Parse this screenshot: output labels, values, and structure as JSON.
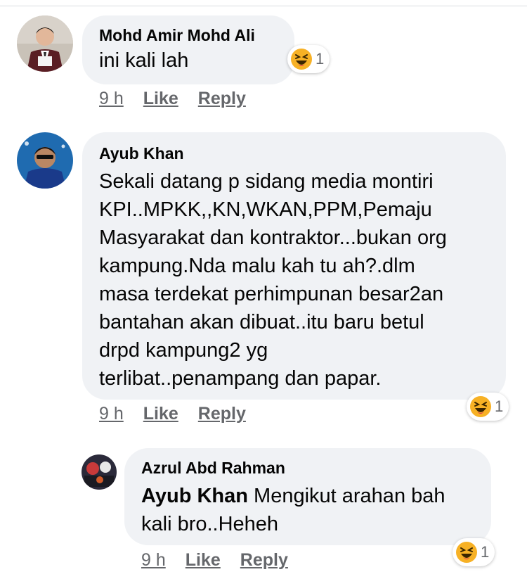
{
  "comments": [
    {
      "author": "Mohd Amir Mohd Ali",
      "text": "ini kali lah",
      "time": "9 h",
      "like": "Like",
      "reply": "Reply",
      "reaction": {
        "icon": "haha-emoji-icon",
        "count": "1"
      }
    },
    {
      "author": "Ayub Khan",
      "lines": [
        "Sekali datang p sidang media montiri",
        "KPI..MPKK,,KN,WKAN,PPM,Pemaju",
        "Masyarakat dan kontraktor...bukan org",
        "kampung.Nda malu kah tu ah?.dlm",
        "masa terdekat perhimpunan besar2an",
        "bantahan akan dibuat..itu baru betul",
        "drpd kampung2 yg",
        "terlibat..penampang dan papar."
      ],
      "time": "9 h",
      "like": "Like",
      "reply": "Reply",
      "reaction": {
        "icon": "haha-emoji-icon",
        "count": "1"
      }
    },
    {
      "author": "Azrul Abd Rahman",
      "mention": "Ayub Khan",
      "text_line1": " Mengikut arahan bah",
      "text_line2": "kali bro..Heheh",
      "time": "9 h",
      "like": "Like",
      "reply": "Reply",
      "reaction": {
        "icon": "haha-emoji-icon",
        "count": "1"
      }
    }
  ],
  "colors": {
    "bubble": "#f0f2f5",
    "meta_text": "#65676b",
    "text": "#050505",
    "haha_yellow": "#f7b125"
  }
}
